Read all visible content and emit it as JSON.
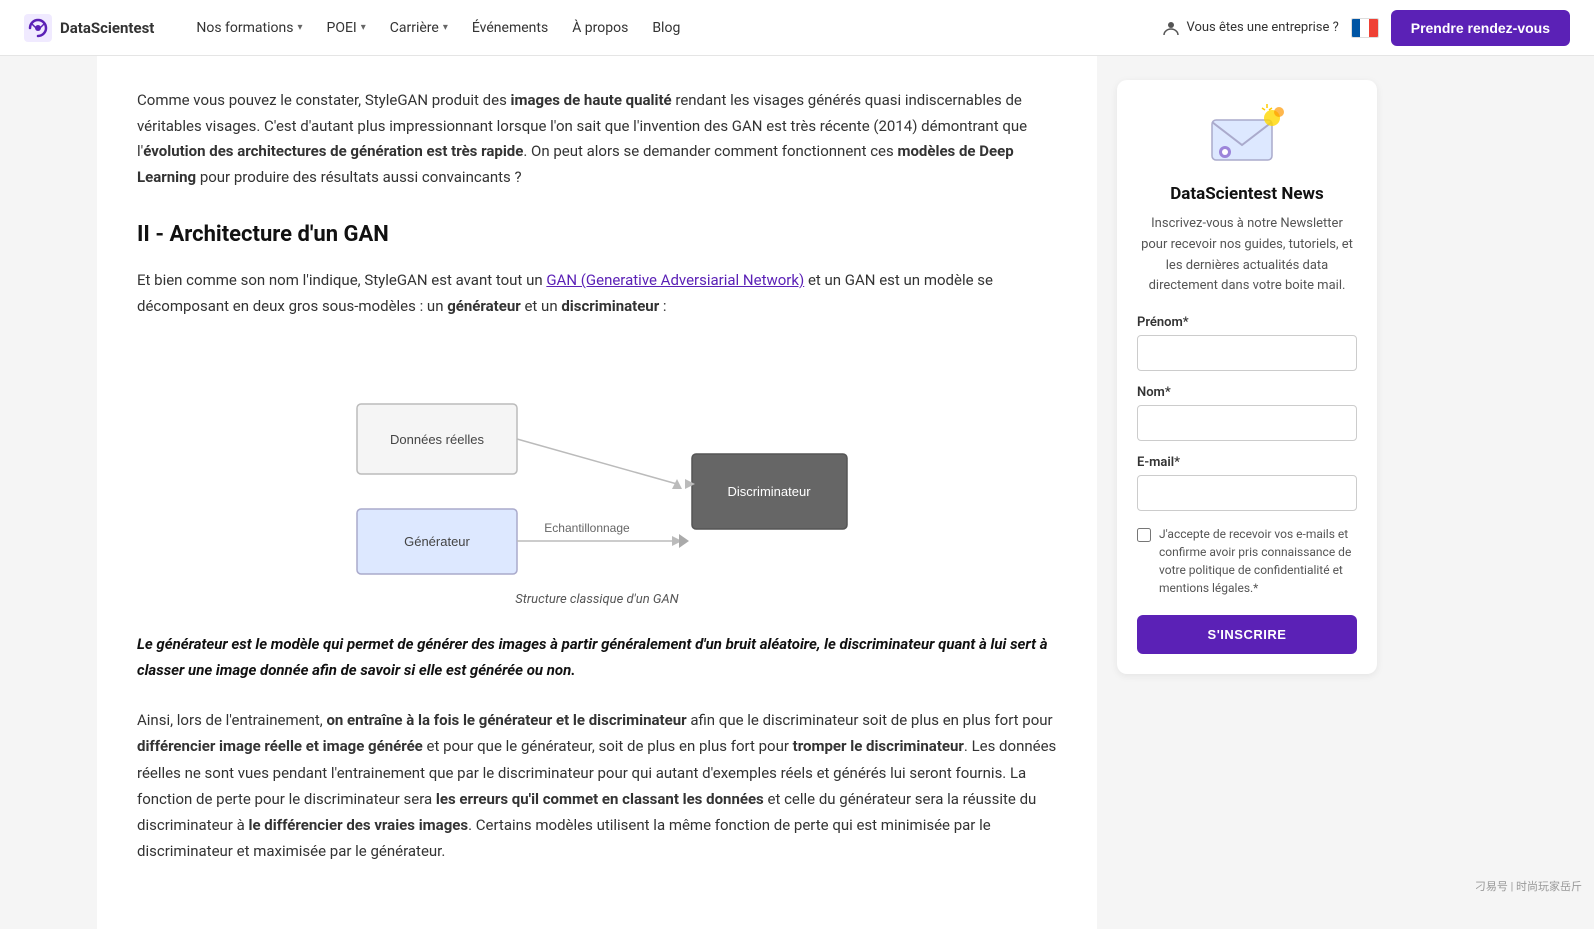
{
  "navbar": {
    "logo_text": "DataScientest",
    "nav_items": [
      {
        "label": "Nos formations",
        "has_chevron": true
      },
      {
        "label": "POEI",
        "has_chevron": true
      },
      {
        "label": "Carrière",
        "has_chevron": true
      },
      {
        "label": "Événements",
        "has_chevron": false
      },
      {
        "label": "À propos",
        "has_chevron": false
      },
      {
        "label": "Blog",
        "has_chevron": false
      }
    ],
    "enterprise_label": "Vous êtes une entreprise ?",
    "cta_label": "Prendre rendez-vous"
  },
  "main": {
    "intro_para_1": "Comme vous pouvez le constater, StyleGAN produit des ",
    "intro_bold_1": "images de haute qualité",
    "intro_para_2": " rendant les visages générés quasi indiscernables de véritables visages. C'est d'autant plus impressionnant lorsque l'on sait que l'invention des GAN est très récente (2014) démontrant que l'",
    "intro_bold_2": "évolution des architectures de génération est très rapide",
    "intro_para_3": ". On peut alors se demander comment fonctionnent ces ",
    "intro_bold_3": "modèles de Deep Learning",
    "intro_para_4": " pour produire des résultats aussi convaincants ?",
    "section_heading": "II - Architecture d'un GAN",
    "body_para_1_pre": "Et bien comme son nom l'indique, StyleGAN est avant tout un ",
    "body_link": "GAN (Generative Adversiarial Network)",
    "body_para_1_post": " et un GAN est un modèle se décomposant en deux gros sous-modèles : un ",
    "body_bold_generator": "générateur",
    "body_para_1_and": " et un ",
    "body_bold_discriminator": "discriminateur",
    "body_para_1_end": " :",
    "diagram_caption": "Structure classique d'un GAN",
    "diagram_box_real": "Données réelles",
    "diagram_box_generator": "Générateur",
    "diagram_box_sampling": "Echantillonnage",
    "diagram_box_discriminator": "Discriminateur",
    "highlight_quote": "Le générateur est le modèle qui permet de générer des images à partir généralement d'un bruit aléatoire, le discriminateur quant à lui sert à classer une image donnée afin de savoir si elle est générée ou non.",
    "body_para_2_pre": "Ainsi, lors de l'entrainement, ",
    "body_para_2_bold1": "on entraîne à la fois le générateur et le discriminateur",
    "body_para_2_mid1": " afin que le discriminateur soit de plus en plus fort pour ",
    "body_para_2_bold2": "différencier image réelle et image générée",
    "body_para_2_mid2": " et pour que le générateur, soit de plus en plus fort pour ",
    "body_para_2_bold3": "tromper le discriminateur",
    "body_para_2_mid3": ". Les données réelles ne sont vues pendant l'entrainement que par le discriminateur pour qui autant d'exemples réels et générés lui seront fournis. La fonction de perte pour le discriminateur sera ",
    "body_para_2_bold4": "les erreurs qu'il commet en classant les données",
    "body_para_2_mid4": " et celle du générateur sera la réussite du discriminateur à ",
    "body_para_2_bold5": "le différencier des vraies images",
    "body_para_2_end": ". Certains modèles utilisent la même fonction de perte qui est minimisée par le discriminateur et maximisée par le générateur."
  },
  "sidebar": {
    "newsletter_title": "DataScientest News",
    "newsletter_desc": "Inscrivez-vous à notre Newsletter pour recevoir nos guides, tutoriels, et les dernières actualités data directement dans votre boite mail.",
    "prenom_label": "Prénom*",
    "prenom_placeholder": "",
    "nom_label": "Nom*",
    "nom_placeholder": "",
    "email_label": "E-mail*",
    "email_placeholder": "",
    "checkbox_label": "J'accepte de recevoir vos e-mails et confirme avoir pris connaissance de votre politique de confidentialité et mentions légales.*",
    "subscribe_btn": "S'INSCRIRE"
  },
  "watermark": {
    "text": "刁易号 | 时尚玩家岳斤"
  }
}
